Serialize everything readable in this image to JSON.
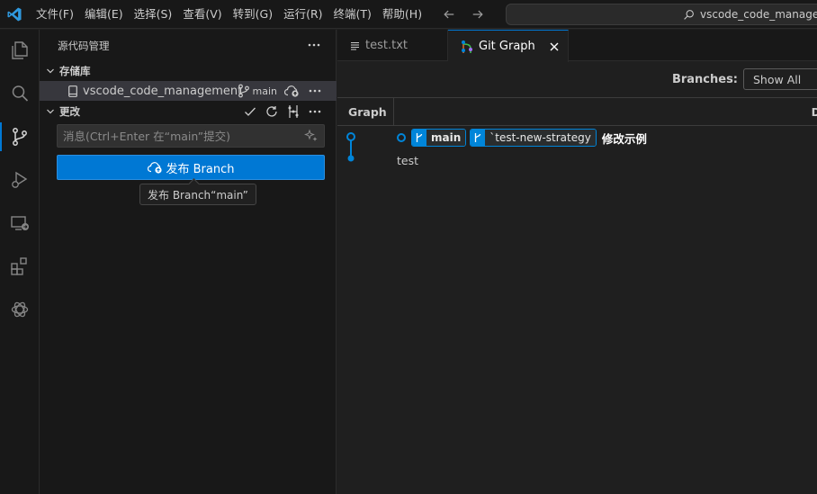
{
  "menu": [
    "文件(F)",
    "编辑(E)",
    "选择(S)",
    "查看(V)",
    "转到(G)",
    "运行(R)",
    "终端(T)",
    "帮助(H)"
  ],
  "command_center": {
    "text": "vscode_code_management"
  },
  "activity_bar": {
    "items": [
      "explorer-icon",
      "search-icon",
      "source-control-icon",
      "run-debug-icon",
      "remote-explorer-icon",
      "extensions-icon",
      "chatgpt-icon"
    ],
    "active": "source-control-icon",
    "accent": "#0078d4"
  },
  "sidebar": {
    "title": "源代码管理",
    "repositories_header": "存储库",
    "repo": {
      "name": "vscode_code_management",
      "branch": "main"
    },
    "changes_header": "更改",
    "commit_message": {
      "value": "",
      "placeholder": "消息(Ctrl+Enter 在“main”提交)"
    },
    "publish_button": "发布 Branch",
    "tooltip": "发布 Branch“main”"
  },
  "editor": {
    "tabs": [
      {
        "label": "test.txt",
        "icon": "text-file-icon",
        "active": false
      },
      {
        "label": "Git Graph",
        "icon": "git-graph-icon",
        "active": true
      }
    ]
  },
  "git_graph": {
    "branches_label": "Branches:",
    "branches_value": "Show All",
    "columns": {
      "graph": "Graph",
      "description_initial": "D"
    },
    "commits": [
      {
        "refs": [
          {
            "name": "main",
            "icon": "branch-icon"
          },
          {
            "name": "`test-new-strategy",
            "icon": "branch-icon"
          }
        ],
        "message": "修改示例"
      },
      {
        "refs": [],
        "message": "test"
      }
    ],
    "graph_color": "#0085d9"
  }
}
